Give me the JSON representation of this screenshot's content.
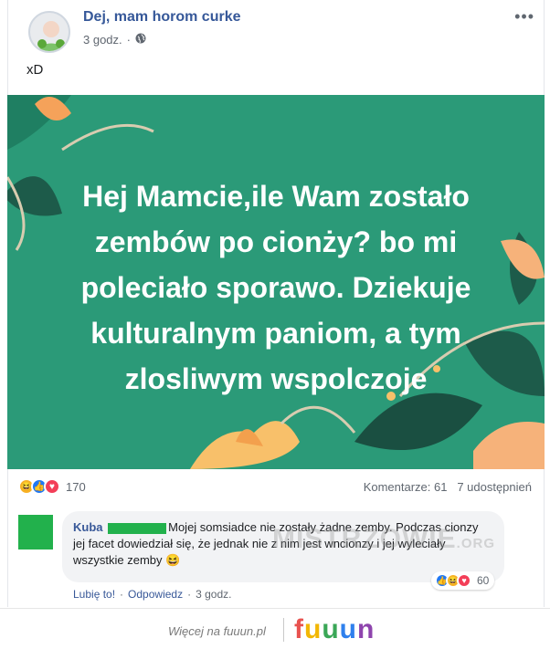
{
  "post": {
    "page_name": "Dej, mam horom curke",
    "time": "3 godz.",
    "audience_icon": "globe-icon",
    "text": "xD",
    "image_text": "Hej Mamcie,ile Wam zostało zembów po cionży? bo mi poleciało sporawo. Dziekuje kulturalnym paniom, a tym zlosliwym wspolczoje",
    "reaction_count": "170",
    "comments_label": "Komentarze: 61",
    "shares_label": "7 udostępnień"
  },
  "comment": {
    "author": "Kuba",
    "text": "Mojej somsiadce nie zostały żadne zemby. Podczas cionzy jej facet dowiedział się, że jednak nie z nim jest wncionzy i jej wyleciały wszystkie zemby",
    "reaction_count": "60",
    "like_label": "Lubię to!",
    "reply_label": "Odpowiedz",
    "time": "3 godz."
  },
  "watermark": {
    "text": "MISTRZOWIE",
    "suffix": ".ORG"
  },
  "footer": {
    "more_text": "Więcej na fuuun.pl",
    "brand": "fuuun",
    "brand_colors": [
      "#e8524f",
      "#f2b705",
      "#3aa757",
      "#2f80ed",
      "#8e44ad"
    ]
  }
}
